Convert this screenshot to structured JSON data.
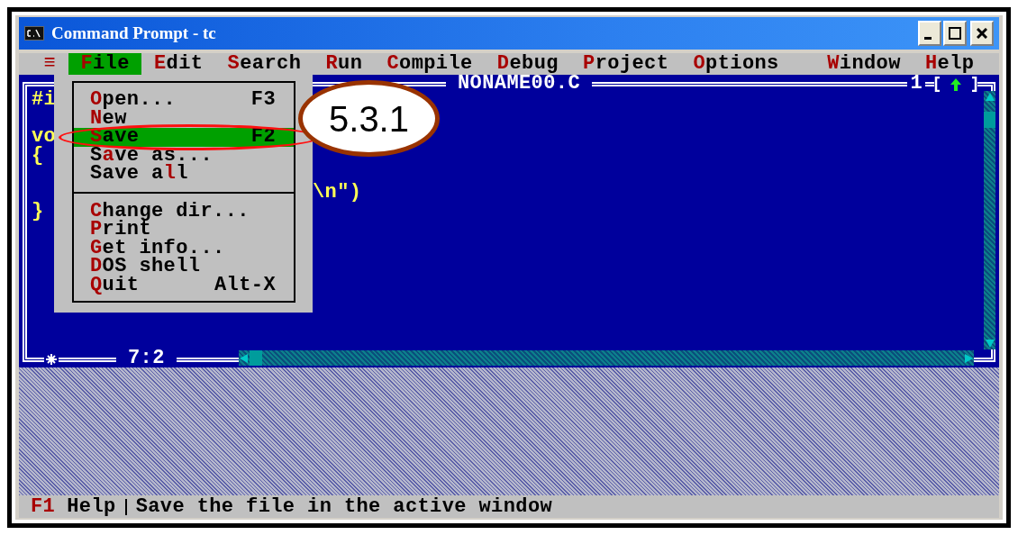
{
  "window": {
    "title": "Command Prompt - tc"
  },
  "menubar": {
    "left": [
      {
        "label": "**≡**",
        "selected": false
      },
      {
        "label": "**F**ile",
        "selected": true
      },
      {
        "label": "**E**dit",
        "selected": false
      },
      {
        "label": "**S**earch",
        "selected": false
      },
      {
        "label": "**R**un",
        "selected": false
      },
      {
        "label": "**C**ompile",
        "selected": false
      },
      {
        "label": "**D**ebug",
        "selected": false
      },
      {
        "label": "**P**roject",
        "selected": false
      },
      {
        "label": "**O**ptions",
        "selected": false
      }
    ],
    "right": [
      {
        "label": "**W**indow",
        "selected": false
      },
      {
        "label": "**H**elp",
        "selected": false
      }
    ]
  },
  "editor": {
    "title": "NONAME00.C",
    "window_number": "1",
    "modified": true,
    "cursor": "7:2",
    "lines": [
      {
        "kind": "code",
        "text": "#i"
      },
      {
        "kind": "blank"
      },
      {
        "kind": "code",
        "text": "vo"
      },
      {
        "kind": "code",
        "text": "{"
      },
      {
        "kind": "blank"
      },
      {
        "kind": "tail",
        "text": "\\n\")"
      },
      {
        "kind": "code",
        "text": "}"
      }
    ]
  },
  "file_menu": {
    "items": [
      {
        "kind": "item",
        "label": "**O**pen...",
        "shortcut": "F3",
        "selected": false
      },
      {
        "kind": "item",
        "label": "**N**ew",
        "selected": false
      },
      {
        "kind": "item",
        "label": "**S**ave",
        "shortcut": "F2",
        "selected": true
      },
      {
        "kind": "item",
        "label": "S**a**ve as...",
        "selected": false
      },
      {
        "kind": "item",
        "label": "Save a**l**l",
        "selected": false
      },
      {
        "kind": "separator"
      },
      {
        "kind": "item",
        "label": "**C**hange dir...",
        "selected": false
      },
      {
        "kind": "item",
        "label": "**P**rint",
        "selected": false
      },
      {
        "kind": "item",
        "label": "**G**et info...",
        "selected": false
      },
      {
        "kind": "item",
        "label": "**D**OS shell",
        "selected": false
      },
      {
        "kind": "item",
        "label": "**Q**uit",
        "shortcut": "Alt-X",
        "selected": false
      }
    ]
  },
  "annotation": {
    "label": "5.3.1"
  },
  "status_bar": {
    "key": "F1",
    "label": "Help",
    "hint": "Save the file in the active window"
  }
}
